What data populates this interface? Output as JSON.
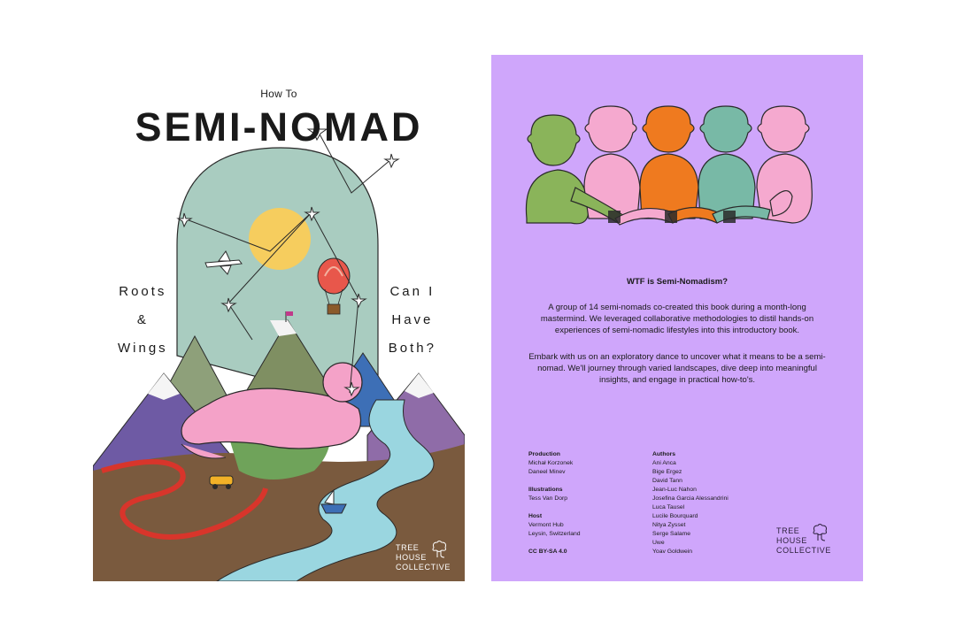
{
  "front": {
    "kicker": "How To",
    "title": "SEMI-NOMAD",
    "left_lines": [
      "Roots",
      "&",
      "Wings"
    ],
    "right_lines": [
      "Can I",
      "Have",
      "Both?"
    ],
    "logo_lines": [
      "TREE",
      "HOUSE",
      "COLLECTIVE"
    ],
    "colors": {
      "sky": "#a9ccc0",
      "sun": "#f6cd5e",
      "river": "#9ad6e0",
      "figure": "#f4a2c8",
      "mountain": "#6e5aa4",
      "road": "#d8352b",
      "ground": "#7a5a3e"
    }
  },
  "back": {
    "heading": "WTF is Semi-Nomadism?",
    "paragraph1": "A group of 14 semi-nomads co-created this book during a month-long mastermind. We leveraged collaborative methodologies to distil hands-on experiences of semi-nomadic lifestyles into this introductory book.",
    "paragraph2": "Embark with us on an exploratory dance to uncover what it means to be a semi-nomad. We'll journey through varied landscapes, dive deep into meaningful insights, and engage in practical how-to's.",
    "credits_left": [
      {
        "heading": "Production",
        "names": [
          "Michał Korzonek",
          "Daneel Minev"
        ]
      },
      {
        "heading": "Illustrations",
        "names": [
          "Tess Van Dorp"
        ]
      },
      {
        "heading": "Host",
        "names": [
          "Vermont Hub",
          "Leysin, Switzerland"
        ]
      }
    ],
    "license": "CC BY-SA 4.0",
    "authors_heading": "Authors",
    "authors": [
      "Ani Anca",
      "Bige Ergez",
      "David Tann",
      "Jean-Luc Nahon",
      "Josefina Garcia Alessandrini",
      "Luca Tausel",
      "Lucile Bourquard",
      "Nitya Zysset",
      "Serge Salame",
      "Uwe",
      "Yoav Goldwein"
    ],
    "logo_lines": [
      "TREE",
      "HOUSE",
      "COLLECTIVE"
    ],
    "colors": {
      "background": "#cfa6fb",
      "green": "#8ab45a",
      "pink": "#f5a9cf",
      "orange": "#ef7a1f",
      "teal": "#78b9a6"
    }
  }
}
